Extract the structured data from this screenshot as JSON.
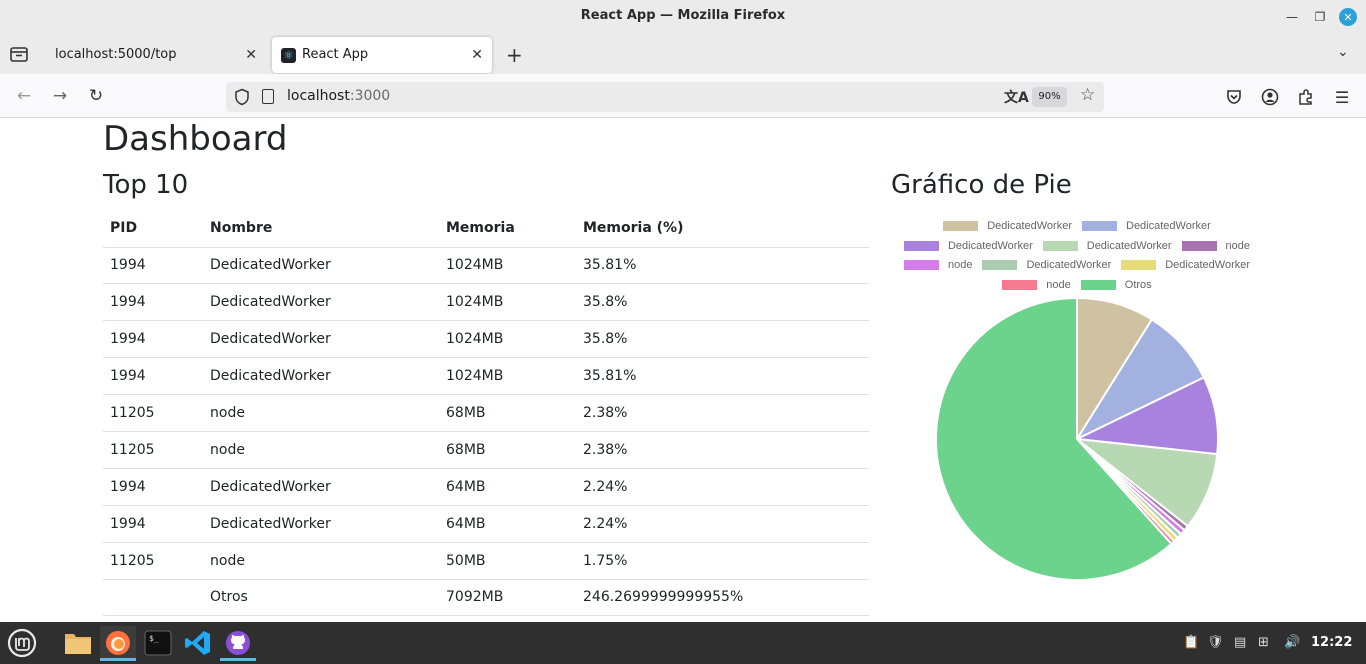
{
  "window": {
    "title": "React App — Mozilla Firefox"
  },
  "tabs": [
    {
      "label": "localhost:5000/top",
      "active": false
    },
    {
      "label": "React App",
      "active": true
    }
  ],
  "urlbar": {
    "host": "localhost",
    "port": ":3000",
    "zoom": "90%"
  },
  "page": {
    "title": "Dashboard",
    "table_title": "Top 10",
    "chart_title": "Gráfico de Pie",
    "table": {
      "headers": [
        "PID",
        "Nombre",
        "Memoria",
        "Memoria (%)"
      ],
      "rows": [
        [
          "1994",
          "DedicatedWorker",
          "1024MB",
          "35.81%"
        ],
        [
          "1994",
          "DedicatedWorker",
          "1024MB",
          "35.8%"
        ],
        [
          "1994",
          "DedicatedWorker",
          "1024MB",
          "35.8%"
        ],
        [
          "1994",
          "DedicatedWorker",
          "1024MB",
          "35.81%"
        ],
        [
          "11205",
          "node",
          "68MB",
          "2.38%"
        ],
        [
          "11205",
          "node",
          "68MB",
          "2.38%"
        ],
        [
          "1994",
          "DedicatedWorker",
          "64MB",
          "2.24%"
        ],
        [
          "1994",
          "DedicatedWorker",
          "64MB",
          "2.24%"
        ],
        [
          "11205",
          "node",
          "50MB",
          "1.75%"
        ],
        [
          "",
          "Otros",
          "7092MB",
          "246.2699999999955%"
        ]
      ]
    }
  },
  "chart_data": {
    "type": "pie",
    "title": "Gráfico de Pie",
    "legend_position": "top",
    "labels": [
      "DedicatedWorker",
      "DedicatedWorker",
      "DedicatedWorker",
      "DedicatedWorker",
      "node",
      "node",
      "DedicatedWorker",
      "DedicatedWorker",
      "node",
      "Otros"
    ],
    "values": [
      1024,
      1024,
      1024,
      1024,
      68,
      68,
      64,
      64,
      50,
      7092
    ],
    "colors": [
      "#cfc2a3",
      "#a3b1e0",
      "#a982e0",
      "#b8d7b3",
      "#a873b0",
      "#d47de8",
      "#a8cdb0",
      "#e8dc7a",
      "#f57a90",
      "#6bd38b"
    ],
    "legend_rows": [
      [
        0,
        1
      ],
      [
        2,
        3,
        4
      ],
      [
        5,
        6,
        7
      ],
      [
        8,
        9
      ]
    ]
  },
  "taskbar": {
    "clock": "12:22"
  }
}
